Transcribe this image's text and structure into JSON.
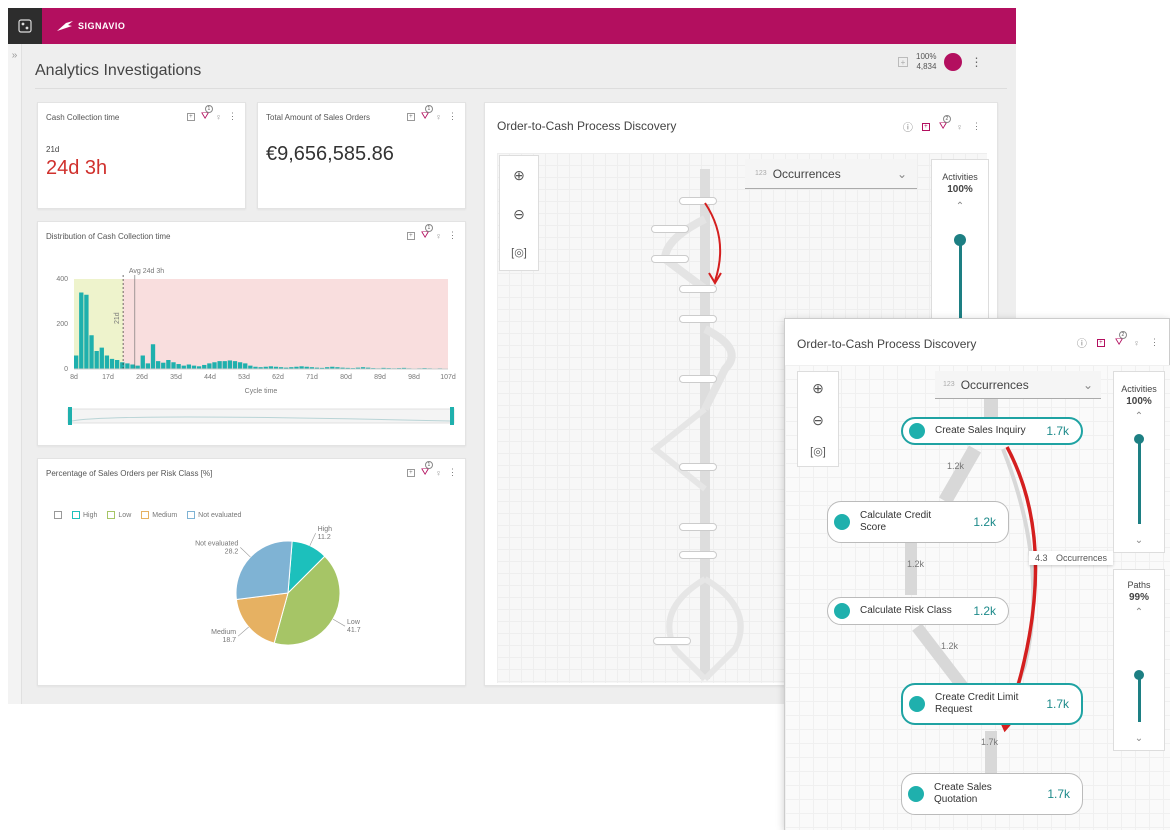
{
  "app": {
    "brand": "SIGNAVIO",
    "collapse_glyph": "»"
  },
  "page": {
    "title": "Analytics Investigations",
    "coverage_percent": "100%",
    "case_count": "4,834"
  },
  "tools": {
    "filter_badge": "1",
    "filter_badge_process": "2",
    "kebab": "⋮",
    "add": "+",
    "info": "ⓘ",
    "bulb": "♀",
    "filter": "⛛"
  },
  "cards": {
    "cash_collection": {
      "title": "Cash Collection time",
      "sub_value": "21d",
      "value": "24d 3h"
    },
    "total_amount": {
      "title": "Total Amount of Sales Orders",
      "value": "€9,656,585.86"
    },
    "distribution": {
      "title": "Distribution of Cash Collection time",
      "avg_label": "Avg 24d 3h",
      "marker_label": "21d",
      "xlabel": "Cycle time"
    },
    "risk": {
      "title": "Percentage of Sales Orders per Risk Class [%]",
      "legend": [
        "High",
        "Low",
        "Medium",
        "Not evaluated"
      ]
    },
    "process": {
      "title": "Order-to-Cash Process Discovery",
      "metric_prefix": "123",
      "metric": "Occurrences",
      "activities_label": "Activities",
      "activities_value": "100%",
      "paths_label": "Paths",
      "paths_value": "99%"
    }
  },
  "zoom_panel": {
    "title": "Order-to-Cash Process Discovery",
    "metric_prefix": "123",
    "metric": "Occurrences",
    "tooltip_value": "4.3",
    "tooltip_label": "Occurrences",
    "nodes": [
      {
        "label": "Create Sales Inquiry",
        "count": "1.7k"
      },
      {
        "label": "Calculate Credit Score",
        "count": "1.2k"
      },
      {
        "label": "Calculate Risk Class",
        "count": "1.2k"
      },
      {
        "label": "Create Credit Limit Request",
        "count": "1.7k"
      },
      {
        "label": "Create Sales Quotation",
        "count": "1.7k"
      }
    ],
    "edges": [
      "1.2k",
      "1.2k",
      "1.2k",
      "1.7k"
    ]
  },
  "chart_data": [
    {
      "type": "bar",
      "title": "Distribution of Cash Collection time",
      "xlabel": "Cycle time",
      "ylabel": "",
      "ylim": [
        0,
        400
      ],
      "yticks": [
        0,
        200,
        400
      ],
      "xticks": [
        "8d",
        "17d",
        "26d",
        "35d",
        "44d",
        "53d",
        "62d",
        "71d",
        "80d",
        "89d",
        "98d",
        "107d"
      ],
      "xlim_days": [
        8,
        107
      ],
      "values": [
        60,
        340,
        330,
        150,
        80,
        95,
        60,
        45,
        40,
        30,
        25,
        20,
        15,
        60,
        25,
        110,
        35,
        28,
        40,
        30,
        22,
        15,
        20,
        15,
        12,
        18,
        25,
        30,
        35,
        35,
        38,
        35,
        30,
        25,
        15,
        10,
        8,
        10,
        12,
        10,
        8,
        6,
        8,
        10,
        12,
        10,
        8,
        6,
        5,
        8,
        10,
        8,
        6,
        5,
        4,
        6,
        8,
        6,
        4,
        3,
        5,
        4,
        3,
        4,
        5,
        3,
        2,
        3,
        4,
        3,
        2,
        3,
        2
      ],
      "avg_days": 24.1,
      "marker_days": 21,
      "color": "#1fb0ad"
    },
    {
      "type": "pie",
      "title": "Percentage of Sales Orders per Risk Class [%]",
      "slices": [
        {
          "name": "High",
          "value": 11.2,
          "color": "#1cc0bc"
        },
        {
          "name": "Low",
          "value": 41.7,
          "color": "#a6c566"
        },
        {
          "name": "Medium",
          "value": 18.7,
          "color": "#e6b162"
        },
        {
          "name": "Not evaluated",
          "value": 28.2,
          "color": "#7fb3d4"
        }
      ]
    }
  ]
}
